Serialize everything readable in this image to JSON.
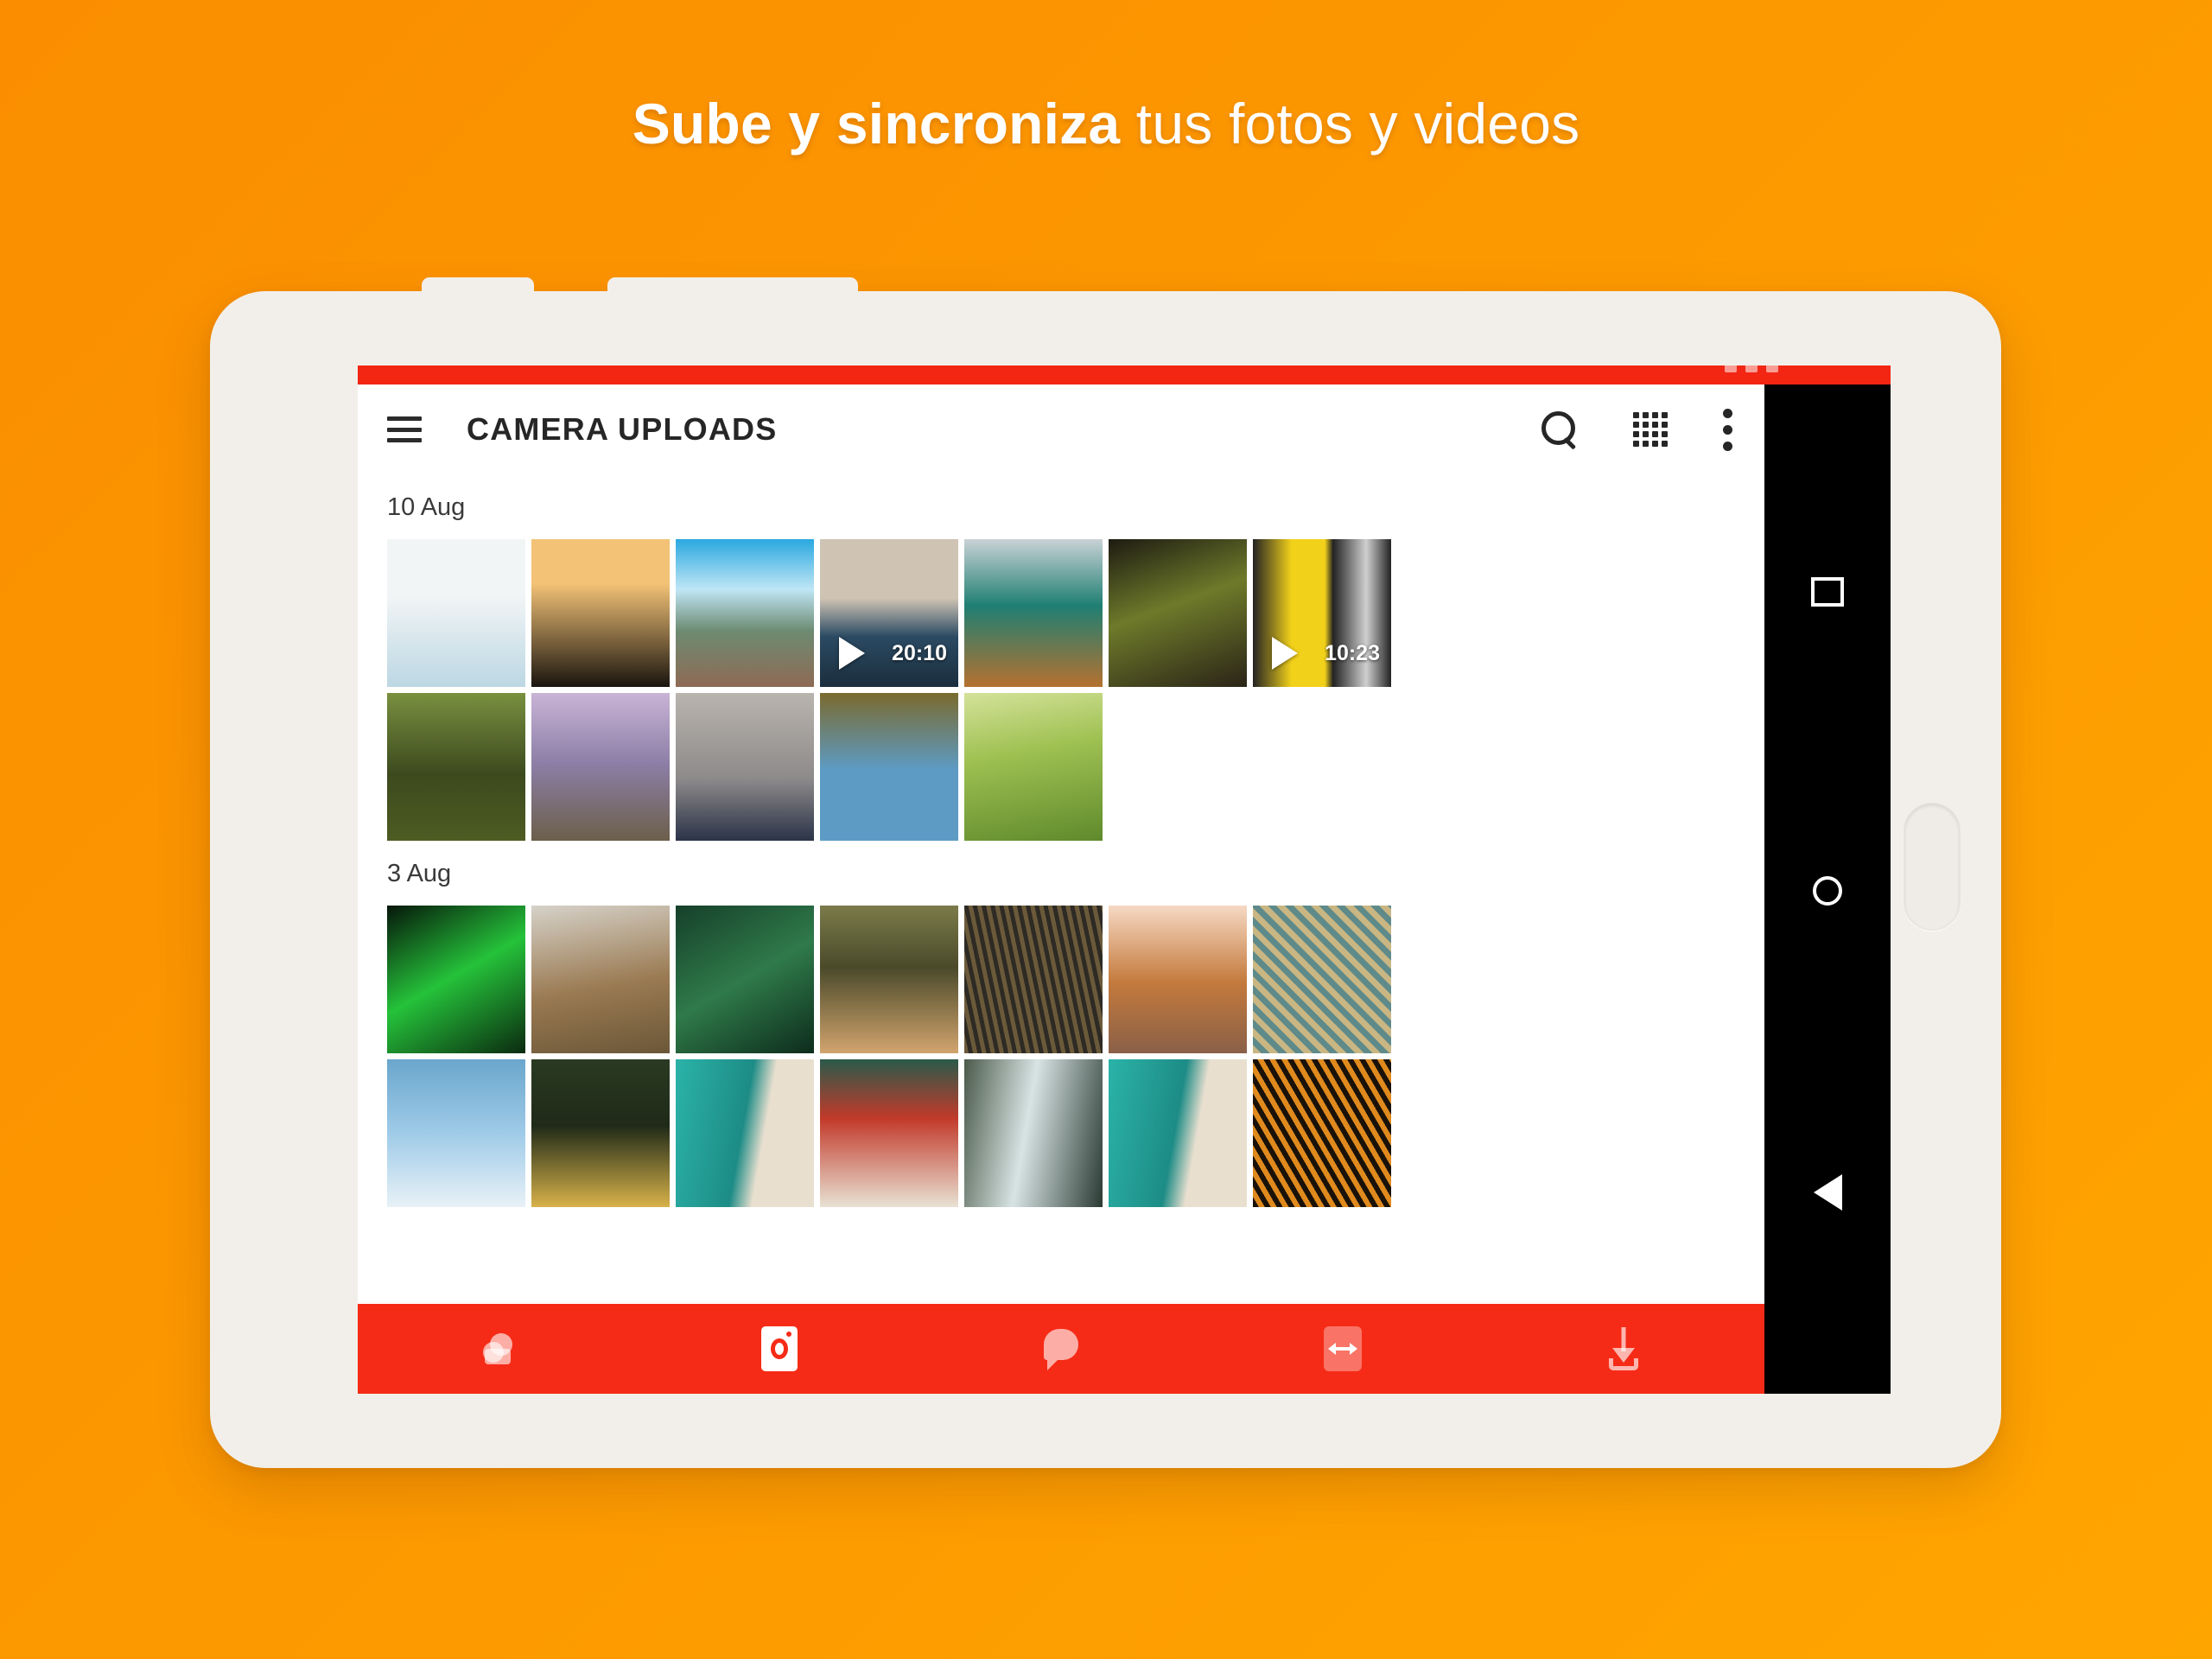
{
  "promo": {
    "headline_bold": "Sube y sincroniza",
    "headline_normal": " tus fotos y videos",
    "background_from": "#FA8E00",
    "background_to": "#FFA500"
  },
  "device": {
    "name": "android-tablet",
    "bezel_color": "#F2EFEA",
    "nav_bar": {
      "recents_label": "recents",
      "home_label": "home",
      "back_label": "back"
    },
    "side_button_label": "fingerprint"
  },
  "app": {
    "accent_color": "#F62B17",
    "status_bar_color": "#F22613",
    "appbar": {
      "menu_icon": "hamburger-icon",
      "title": "CAMERA UPLOADS",
      "actions": [
        {
          "icon": "search-icon",
          "label": "Search"
        },
        {
          "icon": "grid-icon",
          "label": "Grid view"
        },
        {
          "icon": "overflow-menu-icon",
          "label": "More options"
        }
      ]
    },
    "gallery": {
      "sections": [
        {
          "date": "10 Aug",
          "rows": [
            [
              {
                "name": "coastal-cliff-photo",
                "type": "photo",
                "c1": "#f2f5f6",
                "c2": "#6f9f5c",
                "c3": "#bcd7e3",
                "style": "coast"
              },
              {
                "name": "sunset-arch-photo",
                "type": "photo",
                "c1": "#2a2118",
                "c2": "#f3c276",
                "c3": "#1a150f",
                "style": "sunset"
              },
              {
                "name": "canyon-road-photo",
                "type": "photo",
                "c1": "#2aa8e0",
                "c2": "#6d8b72",
                "c3": "#8e6a54",
                "style": "canyon"
              },
              {
                "name": "plants-video",
                "type": "video",
                "duration": "20:10",
                "c1": "#cfc4b4",
                "c2": "#2b4a63",
                "c3": "#1b2e3d",
                "style": "plants"
              },
              {
                "name": "lake-boat-photo",
                "type": "photo",
                "c1": "#c9d2d6",
                "c2": "#1f7f73",
                "c3": "#b5712f",
                "style": "boat"
              },
              {
                "name": "dark-forest-photo",
                "type": "photo",
                "c1": "#1d1b12",
                "c2": "#6e7a2a",
                "c3": "#2a2417",
                "style": "darkforest"
              },
              {
                "name": "road-marking-video",
                "type": "video",
                "duration": "10:23",
                "c1": "#232323",
                "c2": "#f2d11a",
                "c3": "#cfcfcf",
                "style": "road"
              }
            ],
            [
              {
                "name": "tall-trees-photo",
                "type": "photo",
                "c1": "#3c4a1e",
                "c2": "#79903f",
                "c3": "#4d5c22",
                "style": "trees"
              },
              {
                "name": "mountain-dusk-photo",
                "type": "photo",
                "c1": "#c9b4d6",
                "c2": "#8c7ea6",
                "c3": "#6c5f4a",
                "style": "dusk"
              },
              {
                "name": "grey-peaks-photo",
                "type": "photo",
                "c1": "#b9b4ae",
                "c2": "#8d8a8a",
                "c3": "#2b3348",
                "style": "peaks"
              },
              {
                "name": "flamingo-photo",
                "type": "photo",
                "c1": "#7a6a2e",
                "c2": "#5d9bc4",
                "c3": "#f0702a",
                "style": "flamingo"
              },
              {
                "name": "green-grass-photo",
                "type": "photo",
                "c1": "#9fc152",
                "c2": "#5f8a2c",
                "c3": "#d4e29a",
                "style": "grass"
              }
            ]
          ]
        },
        {
          "date": "3 Aug",
          "rows": [
            [
              {
                "name": "fern-leaf-photo",
                "type": "photo",
                "c1": "#06160a",
                "c2": "#25c23a",
                "c3": "#0b2a10",
                "style": "fern"
              },
              {
                "name": "iguana-photo",
                "type": "photo",
                "c1": "#d6d2c9",
                "c2": "#9a7a52",
                "c3": "#6b5738",
                "style": "iguana"
              },
              {
                "name": "aerial-jungle-photo",
                "type": "photo",
                "c1": "#16402a",
                "c2": "#2f7a4a",
                "c3": "#0d2c1c",
                "style": "jungle"
              },
              {
                "name": "impala-deer-photo",
                "type": "photo",
                "c1": "#7b7b4a",
                "c2": "#d2a46e",
                "c3": "#4a4a2a",
                "style": "deer"
              },
              {
                "name": "canyon-texture-photo",
                "type": "photo",
                "c1": "#6b5a3a",
                "c2": "#2e2a24",
                "c3": "#b59a66",
                "style": "texture"
              },
              {
                "name": "sea-stacks-photo",
                "type": "photo",
                "c1": "#f6d9c4",
                "c2": "#c47a3c",
                "c3": "#8a6048",
                "style": "stacks"
              },
              {
                "name": "patterned-rock-photo",
                "type": "photo",
                "c1": "#c9b682",
                "c2": "#5f8a8a",
                "c3": "#8a6a3a",
                "style": "pattern"
              }
            ],
            [
              {
                "name": "sky-clouds-photo",
                "type": "photo",
                "c1": "#9fcbe8",
                "c2": "#e8f1f7",
                "c3": "#6aa6cc",
                "style": "sky"
              },
              {
                "name": "people-crowd-photo",
                "type": "photo",
                "c1": "#2a3a22",
                "c2": "#d8b24a",
                "c3": "#1f2a18",
                "style": "crowd"
              },
              {
                "name": "pool-edge-photo",
                "type": "photo",
                "c1": "#2bb3a8",
                "c2": "#e8dfcf",
                "c3": "#1d8c86",
                "style": "pool"
              },
              {
                "name": "laundry-balcony-photo",
                "type": "photo",
                "c1": "#c23a2a",
                "c2": "#e8e2d4",
                "c3": "#2a5a4a",
                "style": "balcony"
              },
              {
                "name": "waterfall-photo",
                "type": "photo",
                "c1": "#4a5a4a",
                "c2": "#d8e4e4",
                "c3": "#2a3a33",
                "style": "waterfall"
              },
              {
                "name": "pool-edge-2-photo",
                "type": "photo",
                "c1": "#2bb3a8",
                "c2": "#e8dfcf",
                "c3": "#1d8c86",
                "style": "pool"
              },
              {
                "name": "orange-rock-photo",
                "type": "photo",
                "c1": "#1a1208",
                "c2": "#e08a1e",
                "c3": "#3a2a10",
                "style": "orangerock"
              }
            ]
          ]
        }
      ]
    },
    "bottom_toolbar": [
      {
        "name": "cloud-drive-tab",
        "icon": "cloud-icon",
        "active": false
      },
      {
        "name": "camera-uploads-tab",
        "icon": "camera-icon",
        "active": true
      },
      {
        "name": "chat-tab",
        "icon": "chat-icon",
        "active": false
      },
      {
        "name": "transfers-tab",
        "icon": "transfer-icon",
        "active": false
      },
      {
        "name": "offline-tab",
        "icon": "download-icon",
        "active": false
      }
    ]
  }
}
